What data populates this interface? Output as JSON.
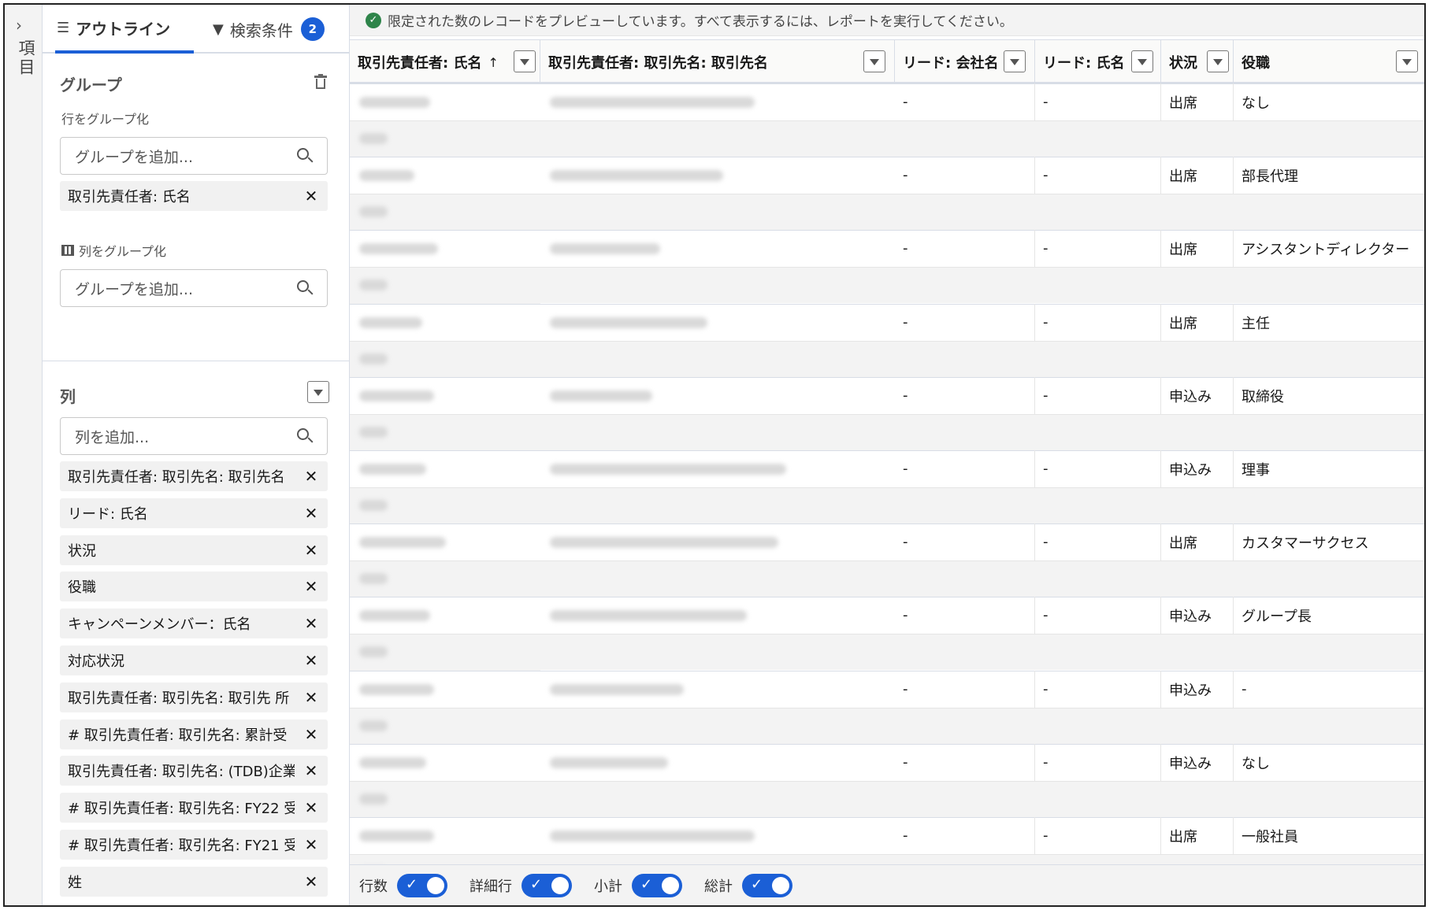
{
  "rail": {
    "label": "項目"
  },
  "tabs": {
    "outline": "アウトライン",
    "filters": "検索条件",
    "filters_count": "2"
  },
  "group": {
    "title": "グループ",
    "rows_label": "行をグループ化",
    "rows_placeholder": "グループを追加...",
    "rows_items": [
      "取引先責任者: 氏名"
    ],
    "cols_label": "列をグループ化",
    "cols_placeholder": "グループを追加..."
  },
  "columns_panel": {
    "title": "列",
    "placeholder": "列を追加...",
    "items": [
      "取引先責任者: 取引先名: 取引先名",
      "リード: 氏名",
      "状況",
      "役職",
      "キャンペーンメンバー：氏名",
      "対応状況",
      "取引先責任者: 取引先名: 取引先 所",
      "# 取引先責任者: 取引先名: 累計受",
      "取引先責任者: 取引先名: (TDB)企業",
      "# 取引先責任者: 取引先名: FY22 受",
      "# 取引先責任者: 取引先名: FY21 受",
      "姓"
    ]
  },
  "banner": {
    "text": "限定された数のレコードをプレビューしています。すべて表示するには、レポートを実行してください。"
  },
  "table": {
    "headers": [
      "取引先責任者: 氏名",
      "取引先責任者: 取引先名: 取引先名",
      "リード: 会社名",
      "リード: 氏名",
      "状況",
      "役職"
    ],
    "sort_arrow": "↑",
    "rows": [
      {
        "company": "-",
        "lead": "-",
        "status": "出席",
        "title": "なし"
      },
      {
        "company": "-",
        "lead": "-",
        "status": "出席",
        "title": "部長代理"
      },
      {
        "company": "-",
        "lead": "-",
        "status": "出席",
        "title": "アシスタントディレクター"
      },
      {
        "company": "-",
        "lead": "-",
        "status": "出席",
        "title": "主任"
      },
      {
        "company": "-",
        "lead": "-",
        "status": "申込み",
        "title": "取締役"
      },
      {
        "company": "-",
        "lead": "-",
        "status": "申込み",
        "title": "理事"
      },
      {
        "company": "-",
        "lead": "-",
        "status": "出席",
        "title": "カスタマーサクセス"
      },
      {
        "company": "-",
        "lead": "-",
        "status": "申込み",
        "title": "グループ長"
      },
      {
        "company": "-",
        "lead": "-",
        "status": "申込み",
        "title": "-"
      },
      {
        "company": "-",
        "lead": "-",
        "status": "申込み",
        "title": "なし"
      },
      {
        "company": "-",
        "lead": "-",
        "status": "出席",
        "title": "一般社員"
      }
    ]
  },
  "footer": {
    "row_count": "行数",
    "detail_rows": "詳細行",
    "subtotal": "小計",
    "grand_total": "総計"
  },
  "colors": {
    "accent": "#1b5fd6",
    "success": "#2e844a"
  }
}
